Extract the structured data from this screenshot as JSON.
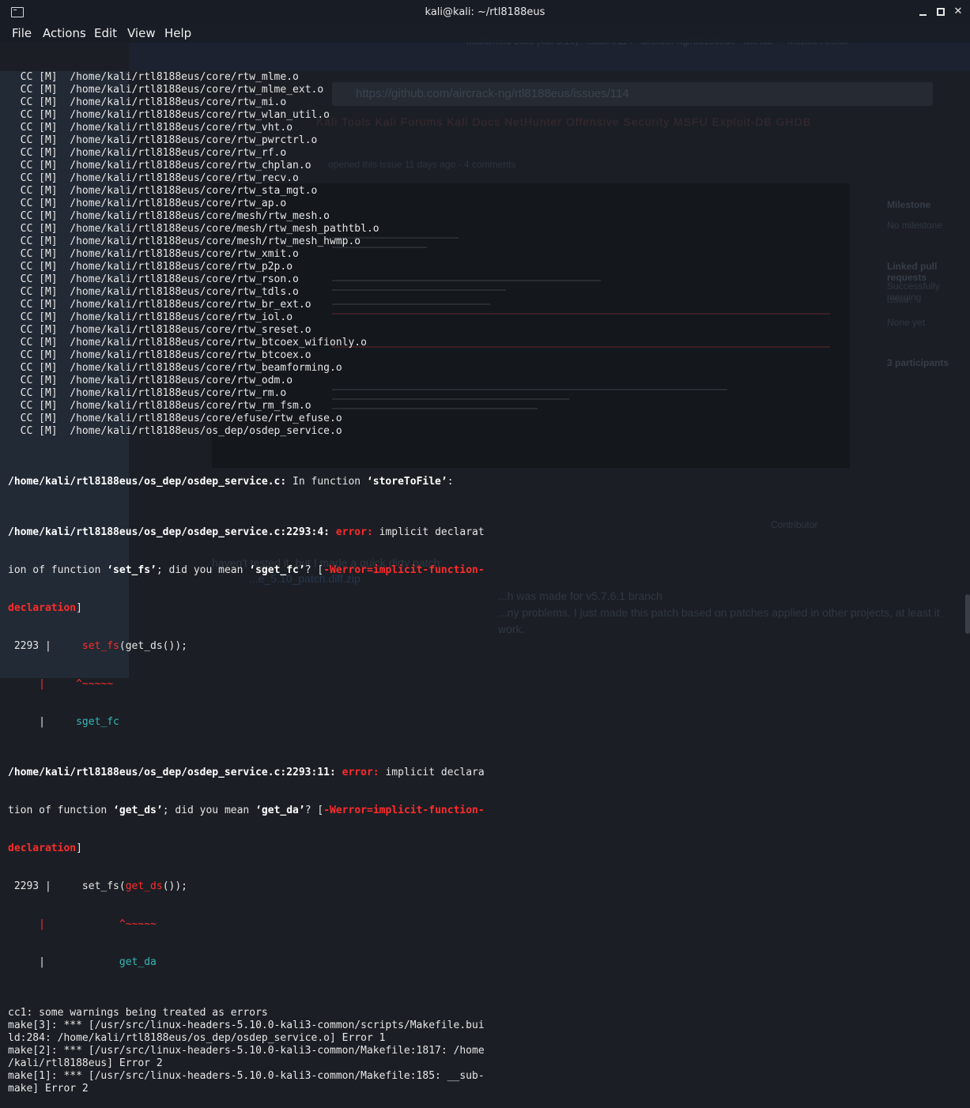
{
  "window": {
    "title": "kali@kali: ~/rtl8188eus",
    "icon": "terminal-icon"
  },
  "menu": [
    "File",
    "Actions",
    "Edit",
    "View",
    "Help"
  ],
  "background_window": {
    "url": "https://github.com/aircrack-ng/rtl8188eus/issues/114",
    "bookmarks": "Kali Tools   Kali Forums   Kali Docs   NetHunter   Offensive Security   MSFU   Exploit-DB   GHDB",
    "sidebar": [
      "Milestone",
      "No milestone",
      "Linked pull requests",
      "Successfully merging",
      "issue.",
      "None yet",
      "3 participants"
    ],
    "comment_lines": [
      "haven't tested it, but I made a quick dirty patch:",
      "...e_5.10_patch.diff.zip",
      "...h was made for v5.7.6.1 branch",
      "...ny problems. I just made this patch based on patches applied in other projects, at least it",
      "work."
    ],
    "contributor": "Contributor"
  },
  "cc_lines": [
    "/home/kali/rtl8188eus/core/rtw_mlme.o",
    "/home/kali/rtl8188eus/core/rtw_mlme_ext.o",
    "/home/kali/rtl8188eus/core/rtw_mi.o",
    "/home/kali/rtl8188eus/core/rtw_wlan_util.o",
    "/home/kali/rtl8188eus/core/rtw_vht.o",
    "/home/kali/rtl8188eus/core/rtw_pwrctrl.o",
    "/home/kali/rtl8188eus/core/rtw_rf.o",
    "/home/kali/rtl8188eus/core/rtw_chplan.o",
    "/home/kali/rtl8188eus/core/rtw_recv.o",
    "/home/kali/rtl8188eus/core/rtw_sta_mgt.o",
    "/home/kali/rtl8188eus/core/rtw_ap.o",
    "/home/kali/rtl8188eus/core/mesh/rtw_mesh.o",
    "/home/kali/rtl8188eus/core/mesh/rtw_mesh_pathtbl.o",
    "/home/kali/rtl8188eus/core/mesh/rtw_mesh_hwmp.o",
    "/home/kali/rtl8188eus/core/rtw_xmit.o",
    "/home/kali/rtl8188eus/core/rtw_p2p.o",
    "/home/kali/rtl8188eus/core/rtw_rson.o",
    "/home/kali/rtl8188eus/core/rtw_tdls.o",
    "/home/kali/rtl8188eus/core/rtw_br_ext.o",
    "/home/kali/rtl8188eus/core/rtw_iol.o",
    "/home/kali/rtl8188eus/core/rtw_sreset.o",
    "/home/kali/rtl8188eus/core/rtw_btcoex_wifionly.o",
    "/home/kali/rtl8188eus/core/rtw_btcoex.o",
    "/home/kali/rtl8188eus/core/rtw_beamforming.o",
    "/home/kali/rtl8188eus/core/rtw_odm.o",
    "/home/kali/rtl8188eus/core/rtw_rm.o",
    "/home/kali/rtl8188eus/core/rtw_rm_fsm.o",
    "/home/kali/rtl8188eus/core/efuse/rtw_efuse.o",
    "/home/kali/rtl8188eus/os_dep/osdep_service.o"
  ],
  "cc_prefix": "  CC [M]  ",
  "errors": {
    "in_function": {
      "file": "/home/kali/rtl8188eus/os_dep/osdep_service.c:",
      "text": " In function ",
      "func": "‘storeToFile’",
      "end": ":"
    },
    "error1": {
      "loc": "/home/kali/rtl8188eus/os_dep/osdep_service.c:2293:4:",
      "label": " error:",
      "msg1": " implicit declarat",
      "msg2a": "ion of function ",
      "fn": "‘set_fs’",
      "msg2b": "; did you mean ",
      "sugg": "‘sget_fc’",
      "msg2c": "? [",
      "flag1": "-Werror=implicit-function-",
      "flag2": "declaration",
      "close": "]",
      "src_num": " 2293 |     ",
      "src_hl": "set_fs",
      "src_rest": "(get_ds());",
      "caret": "     |     ^~~~~~",
      "fix_bar": "     |     ",
      "fix": "sget_fc"
    },
    "error2": {
      "loc": "/home/kali/rtl8188eus/os_dep/osdep_service.c:2293:11:",
      "label": " error:",
      "msg1": " implicit declara",
      "msg2a": "tion of function ",
      "fn": "‘get_ds’",
      "msg2b": "; did you mean ",
      "sugg": "‘get_da’",
      "msg2c": "? [",
      "flag1": "-Werror=implicit-function-",
      "flag2": "declaration",
      "close": "]",
      "src_num": " 2293 |     set_fs(",
      "src_hl": "get_ds",
      "src_rest": "());",
      "caret": "     |            ^~~~~~",
      "fix_bar": "     |            ",
      "fix": "get_da"
    }
  },
  "tail_lines": [
    "cc1: some warnings being treated as errors",
    "make[3]: *** [/usr/src/linux-headers-5.10.0-kali3-common/scripts/Makefile.bui",
    "ld:284: /home/kali/rtl8188eus/os_dep/osdep_service.o] Error 1",
    "make[2]: *** [/usr/src/linux-headers-5.10.0-kali3-common/Makefile:1817: /home",
    "/kali/rtl8188eus] Error 2",
    "make[1]: *** [/usr/src/linux-headers-5.10.0-kali3-common/Makefile:185: __sub-",
    "make] Error 2"
  ],
  "colors": {
    "error": "#ff2b2b",
    "hint": "#36b7b7",
    "text": "#e6e6e6"
  }
}
